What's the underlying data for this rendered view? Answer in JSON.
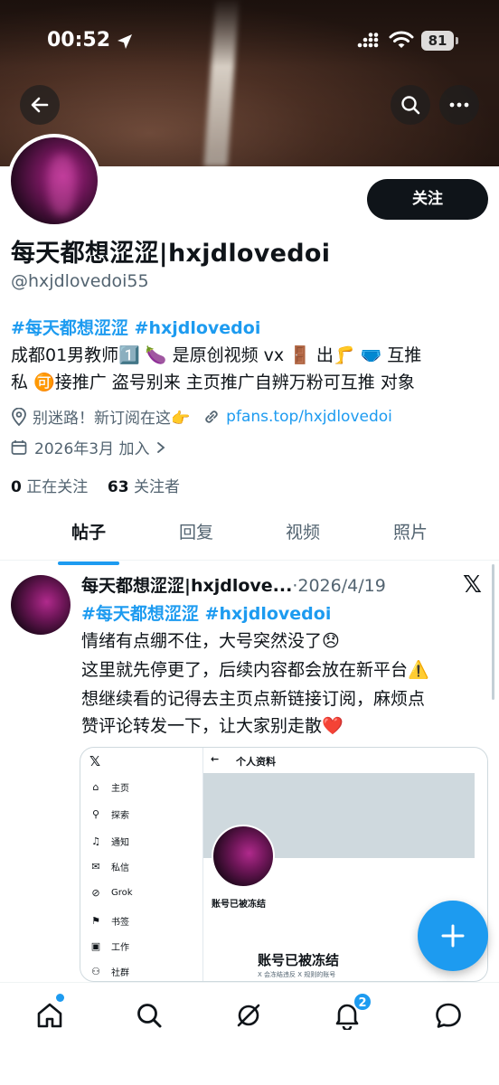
{
  "status_bar": {
    "time": "00:52",
    "battery": "81"
  },
  "profile": {
    "follow_label": "关注",
    "display_name": "每天都想涩涩|hxjdlovedoi",
    "handle": "@hxjdlovedoi55",
    "bio_tags": "#每天都想涩涩 #hxjdlovedoi",
    "bio_line1": "成都01男教师1️⃣ 🍆 是原创视频 vx 🚪 出🦵 🩲 互推",
    "bio_line2": "私 🉑接推广 盗号别来 主页推广自辨万粉可互推 对象",
    "location": "别迷路！新订阅在这👉",
    "link": "pfans.top/hxjdlovedoi",
    "joined": "2026年3月 加入",
    "following_count": "0",
    "following_label": "正在关注",
    "followers_count": "63",
    "followers_label": "关注者"
  },
  "tabs": [
    {
      "label": "帖子",
      "active": true
    },
    {
      "label": "回复",
      "active": false
    },
    {
      "label": "视频",
      "active": false
    },
    {
      "label": "照片",
      "active": false
    }
  ],
  "post": {
    "author": "每天都想涩涩|hxjdlove...",
    "date": "·2026/4/19",
    "tags": "#每天都想涩涩 #hxjdlovedoi",
    "lines": [
      "情绪有点绷不住，大号突然没了😞",
      "这里就先停更了，后续内容都会放在新平台⚠️",
      "想继续看的记得去主页点新链接订阅，麻烦点",
      "赞评论转发一下，让大家别走散❤️"
    ],
    "embed": {
      "logo": "𝕏",
      "back": "←",
      "title": "个人资料",
      "menu": [
        "主页",
        "探索",
        "通知",
        "私信",
        "Grok",
        "书签",
        "工作",
        "社群"
      ],
      "frozen_small": "账号已被冻结",
      "frozen_big": "账号已被冻结",
      "frozen_note": "X 会冻结违反 X 规则的账号"
    }
  },
  "notifications_badge": "2",
  "colors": {
    "accent": "#1d9bf0",
    "text": "#0f1419",
    "muted": "#536471"
  }
}
